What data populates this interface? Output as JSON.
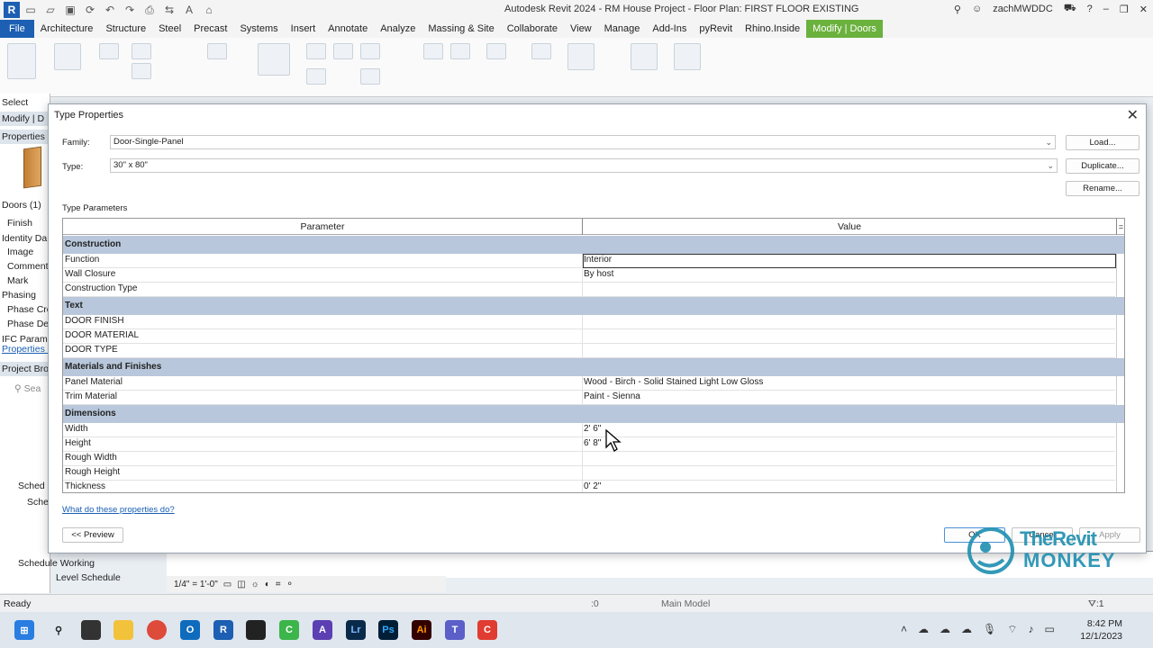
{
  "window": {
    "title": "Autodesk Revit 2024 - RM House Project - Floor Plan: FIRST FLOOR EXISTING",
    "user": "zachMWDDC",
    "logo": "R"
  },
  "ribbon_tabs": [
    "File",
    "Architecture",
    "Structure",
    "Steel",
    "Precast",
    "Systems",
    "Insert",
    "Annotate",
    "Analyze",
    "Massing & Site",
    "Collaborate",
    "View",
    "Manage",
    "Add-Ins",
    "pyRevit",
    "Rhino.Inside",
    "Modify | Doors"
  ],
  "left_panel": {
    "select": "Select",
    "modify_label": "Modify | D",
    "properties_header": "Properties",
    "doors_count": "Doors (1)",
    "rows": [
      "Finish",
      "Identity Da",
      "Image",
      "Comment",
      "Mark",
      "Phasing",
      "Phase Crea",
      "Phase Der",
      "IFC Parame"
    ],
    "properties_link": "Properties h",
    "project_browser": "Project Bro",
    "search_placeholder": "Sea",
    "sched_items": [
      "Sched",
      "Sche"
    ],
    "schedule_working": "Schedule Working",
    "level_schedule": "Level Schedule"
  },
  "dialog": {
    "title": "Type Properties",
    "family_label": "Family:",
    "family_value": "Door-Single-Panel",
    "type_label": "Type:",
    "type_value": "30\" x 80\"",
    "load_btn": "Load...",
    "duplicate_btn": "Duplicate...",
    "rename_btn": "Rename...",
    "type_parameters_label": "Type Parameters",
    "col_parameter": "Parameter",
    "col_value": "Value",
    "col_eq": "=",
    "rows": [
      {
        "kind": "group",
        "param": "Construction",
        "value": ""
      },
      {
        "kind": "row",
        "param": "Function",
        "value": "Interior",
        "selected": true
      },
      {
        "kind": "row",
        "param": "Wall Closure",
        "value": "By host"
      },
      {
        "kind": "row",
        "param": "Construction Type",
        "value": ""
      },
      {
        "kind": "group",
        "param": "Text",
        "value": ""
      },
      {
        "kind": "row",
        "param": "DOOR FINISH",
        "value": ""
      },
      {
        "kind": "row",
        "param": "DOOR MATERIAL",
        "value": ""
      },
      {
        "kind": "row",
        "param": "DOOR TYPE",
        "value": ""
      },
      {
        "kind": "group",
        "param": "Materials and Finishes",
        "value": ""
      },
      {
        "kind": "row",
        "param": "Panel Material",
        "value": "Wood - Birch - Solid Stained Light Low Gloss"
      },
      {
        "kind": "row",
        "param": "Trim Material",
        "value": "Paint - Sienna"
      },
      {
        "kind": "group",
        "param": "Dimensions",
        "value": ""
      },
      {
        "kind": "row",
        "param": "Width",
        "value": "2'  6\""
      },
      {
        "kind": "row",
        "param": "Height",
        "value": "6'  8\""
      },
      {
        "kind": "row",
        "param": "Rough Width",
        "value": ""
      },
      {
        "kind": "row",
        "param": "Rough Height",
        "value": ""
      },
      {
        "kind": "row",
        "param": "Thickness",
        "value": "0'  2\""
      }
    ],
    "help_link": "What do these properties do?",
    "preview_btn": "<< Preview",
    "ok_btn": "OK",
    "cancel_btn": "Cancel",
    "apply_btn": "Apply"
  },
  "view_bar": {
    "scale": "1/4\" = 1'-0\""
  },
  "status": {
    "ready": "Ready",
    "model": "Main Model",
    "selection_count": ":0",
    "filter": ":1"
  },
  "clock": {
    "time": "8:42 PM",
    "date": "12/1/2023"
  },
  "watermark": {
    "line1": "TheRevit",
    "line2": "MONKEY"
  },
  "colors": {
    "accent": "#1c5fb3",
    "context_tab": "#6bb13d",
    "group_row": "#b8c7db"
  }
}
